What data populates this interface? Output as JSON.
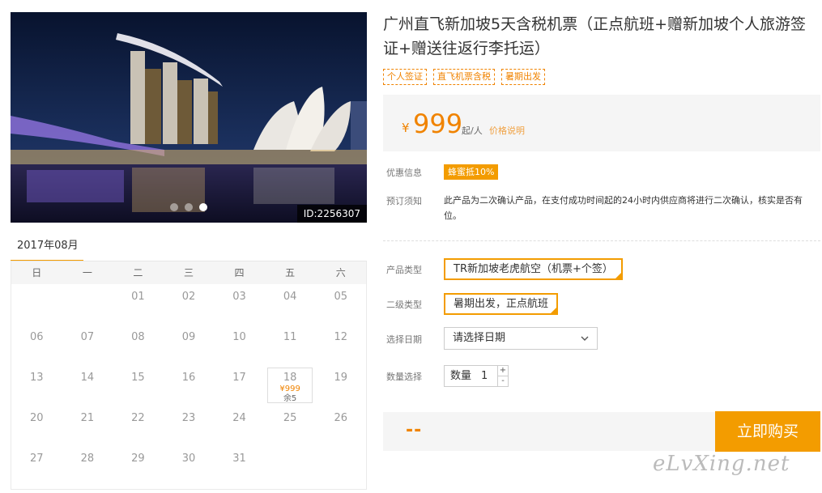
{
  "hero": {
    "id_label": "ID:2256307",
    "slides": 3,
    "active_slide": 3
  },
  "calendar": {
    "month_label": "2017年08月",
    "weekdays": [
      "日",
      "一",
      "二",
      "三",
      "四",
      "五",
      "六"
    ],
    "days": [
      "",
      "",
      "01",
      "02",
      "03",
      "04",
      "05",
      "06",
      "07",
      "08",
      "09",
      "10",
      "11",
      "12",
      "13",
      "14",
      "15",
      "16",
      "17",
      "18",
      "19",
      "20",
      "21",
      "22",
      "23",
      "24",
      "25",
      "26",
      "27",
      "28",
      "29",
      "30",
      "31",
      "",
      ""
    ],
    "selected": {
      "day": "18",
      "price": "¥999",
      "stock": "余5"
    }
  },
  "product": {
    "title": "广州直飞新加坡5天含税机票（正点航班+赠新加坡个人旅游签证+赠送往返行李托运）",
    "tags": [
      "个人签证",
      "直飞机票含税",
      "暑期出发"
    ],
    "price_currency": "¥",
    "price_value": "999",
    "price_unit": "起/人",
    "price_note": "价格说明"
  },
  "info": {
    "discount_label": "优惠信息",
    "discount_badge": "蜂蜜抵10%",
    "notice_label": "预订须知",
    "notice_text": "此产品为二次确认产品，在支付成功时间起的24小时内供应商将进行二次确认，核实是否有位。"
  },
  "options": {
    "type_label": "产品类型",
    "type_value": "TR新加坡老虎航空（机票+个签）",
    "sub_label": "二级类型",
    "sub_value": "暑期出发，正点航班",
    "date_label": "选择日期",
    "date_placeholder": "请选择日期",
    "qty_label": "数量选择",
    "qty_prefix": "数量",
    "qty_value": "1",
    "qty_up": "+",
    "qty_down": "-"
  },
  "buy": {
    "total": "--",
    "button": "立即购买"
  },
  "watermark": "eLvXing.net",
  "colors": {
    "accent": "#f39c00",
    "price": "#f08300"
  }
}
